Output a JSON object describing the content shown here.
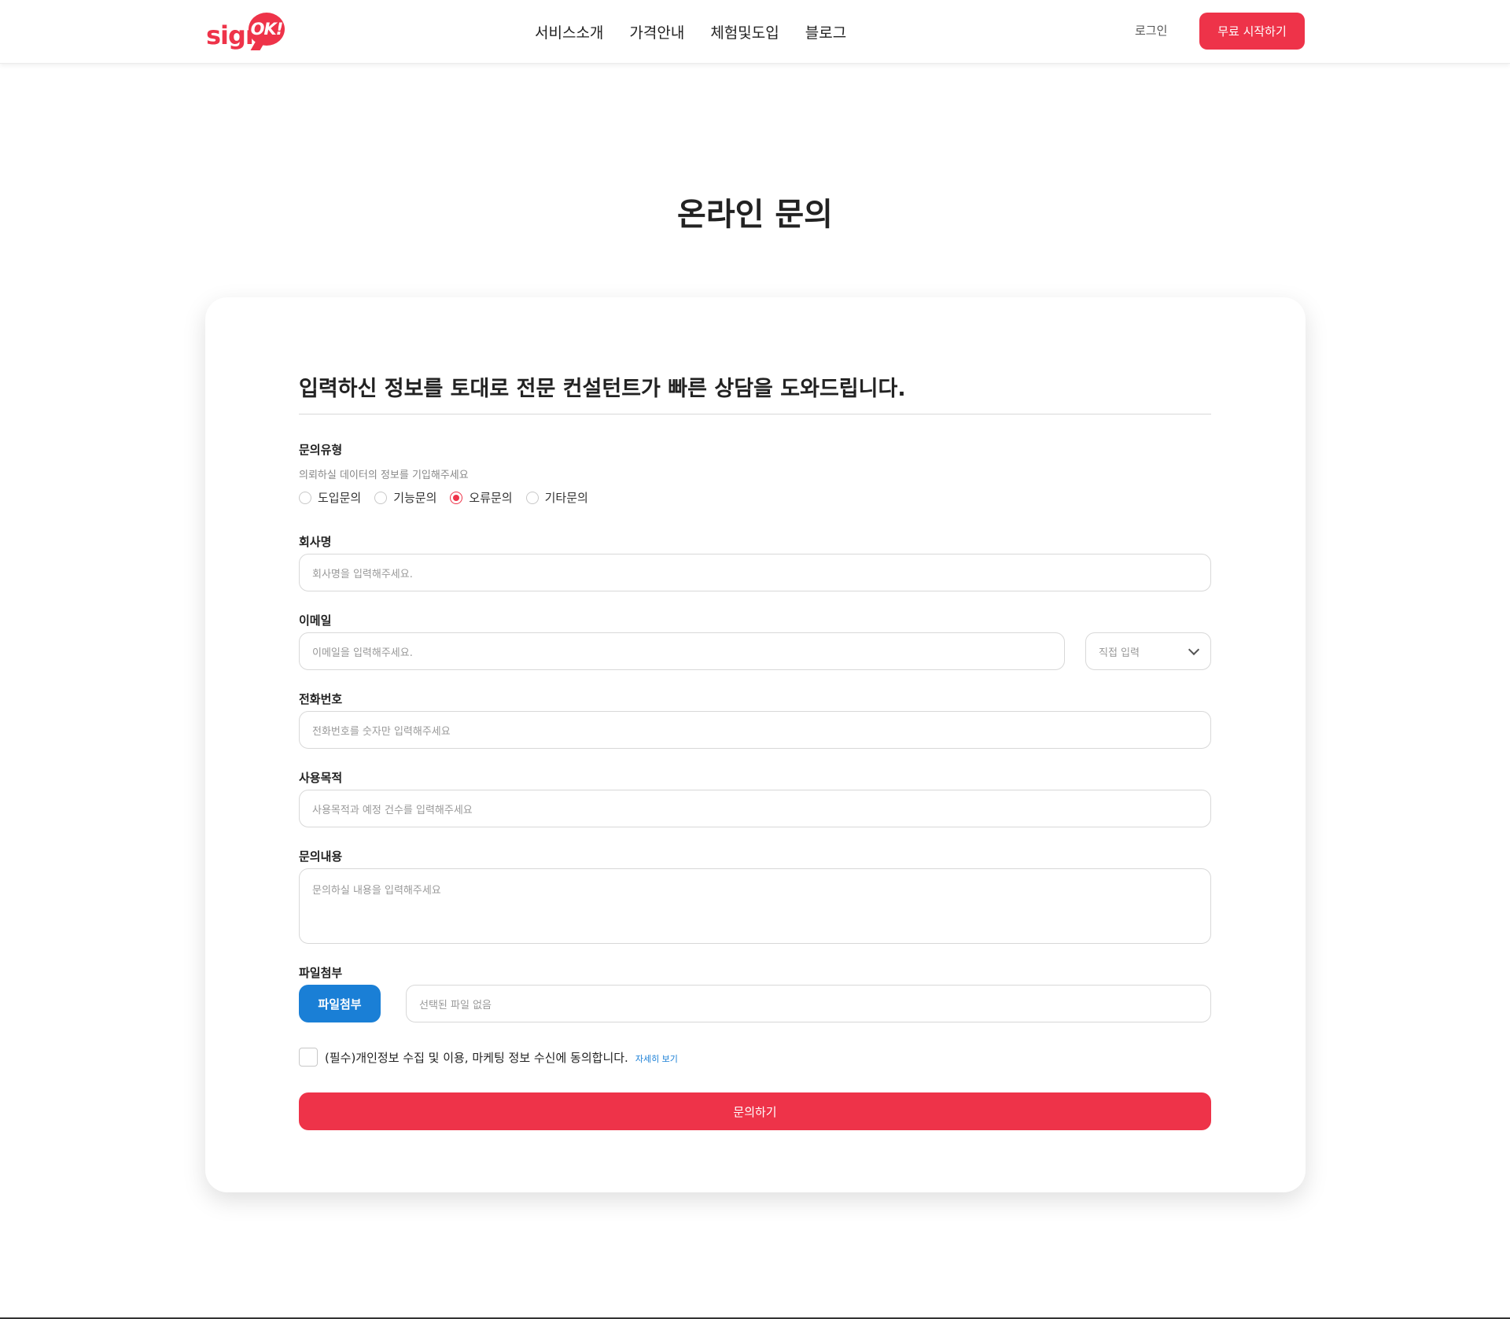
{
  "brand": {
    "logo_sign": "sign",
    "logo_ok": "OK!",
    "accent_color": "#ee3349",
    "file_button_color": "#1a7fd6"
  },
  "nav": {
    "items": [
      "서비스소개",
      "가격안내",
      "체험및도입",
      "블로그"
    ]
  },
  "header": {
    "login_label": "로그인",
    "start_label": "무료 시작하기"
  },
  "page": {
    "title": "온라인 문의"
  },
  "form": {
    "heading": "입력하신 정보를 토대로 전문 컨설턴트가 빠른 상담을 도와드립니다.",
    "inquiry_type": {
      "label": "문의유형",
      "helper": "의뢰하실 데이터의 정보를 기입해주세요",
      "options": [
        "도입문의",
        "기능문의",
        "오류문의",
        "기타문의"
      ],
      "selected": "오류문의"
    },
    "company": {
      "label": "회사명",
      "placeholder": "회사명을 입력해주세요."
    },
    "email": {
      "label": "이메일",
      "placeholder": "이메일을 입력해주세요.",
      "domain_value": "직접 입력"
    },
    "phone": {
      "label": "전화번호",
      "placeholder": "전화번호를 숫자만 입력해주세요"
    },
    "purpose": {
      "label": "사용목적",
      "placeholder": "사용목적과 예정 건수를 입력해주세요"
    },
    "content": {
      "label": "문의내용",
      "placeholder": "문의하실 내용을 입력해주세요"
    },
    "attachment": {
      "label": "파일첨부",
      "button_label": "파일첨부",
      "file_status": "선택된 파일 없음"
    },
    "agreement": {
      "text": "(필수)개인정보 수집 및 이용, 마케팅 정보 수신에 동의합니다.",
      "link": "자세히 보기",
      "checked": false
    },
    "submit_label": "문의하기"
  }
}
